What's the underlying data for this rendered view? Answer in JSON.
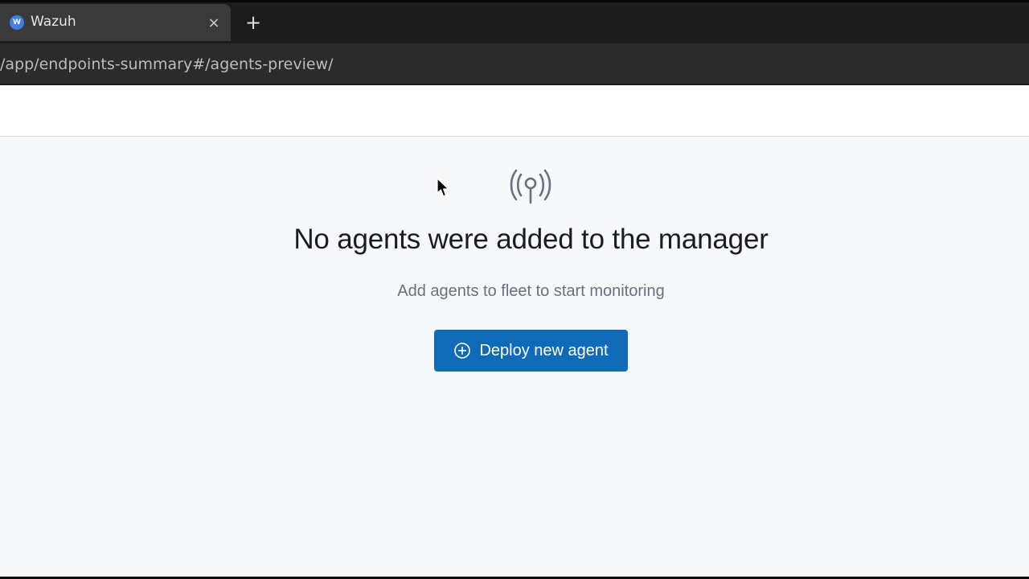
{
  "browser": {
    "tab": {
      "favicon_letter": "W",
      "title": "Wazuh",
      "close_glyph": "×"
    },
    "new_tab_glyph": "+",
    "address": "/app/endpoints-summary#/agents-preview/"
  },
  "empty_state": {
    "icon": "antenna-broadcast-icon",
    "title": "No agents were added to the manager",
    "subtitle": "Add agents to fleet to start monitoring",
    "button": {
      "icon": "plus-in-circle-icon",
      "label": "Deploy new agent"
    }
  },
  "colors": {
    "primary_button": "#0f6bb8",
    "page_background": "#f7f8fa",
    "icon_gray": "#69707d"
  }
}
